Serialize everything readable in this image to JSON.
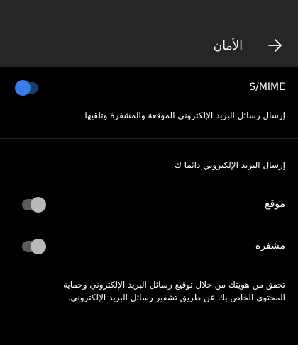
{
  "header": {
    "title": "الأمان",
    "back_icon": "arrow-right-icon"
  },
  "smime": {
    "label": "S/MIME",
    "enabled": true,
    "description": "إرسال رسائل البريد الإلكتروني الموقعة والمشفرة وتلقيها"
  },
  "always_send": {
    "heading": "إرسال البريد الإلكتروني دائما ك",
    "signed_label": "موقع",
    "signed_enabled": false,
    "encrypted_label": "مشفرة",
    "encrypted_enabled": false
  },
  "footer": {
    "description": "تحقق من هويتك من خلال توقيع رسائل البريد الإلكتروني وحماية المحتوى الخاص بك عن طريق تشفير رسائل البريد الإلكتروني."
  },
  "colors": {
    "header_bg": "#262626",
    "toggle_on": "#3a7de8",
    "toggle_off": "#b9b9b9"
  }
}
